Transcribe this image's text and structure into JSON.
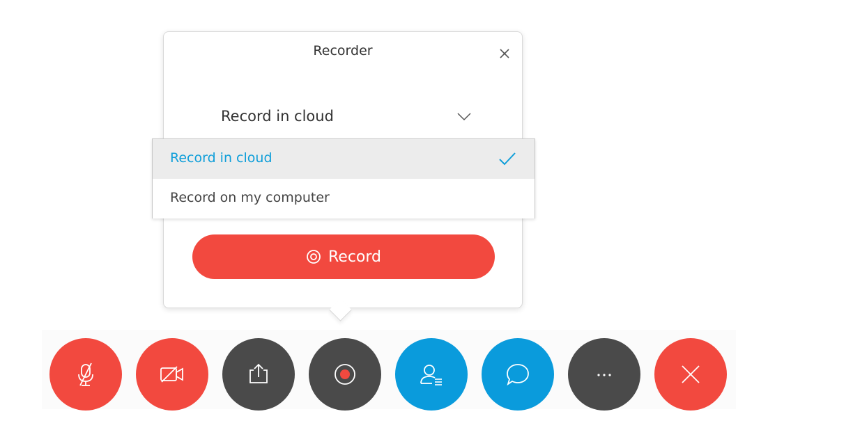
{
  "recorder": {
    "title": "Recorder",
    "mode_selected": "Record in cloud",
    "options": [
      "Record in cloud",
      "Record on my computer"
    ],
    "record_label": "Record"
  },
  "icons": {
    "close": "close-icon",
    "chevron": "chevron-down-icon",
    "check": "check-icon",
    "record": "record-icon"
  },
  "toolbar": {
    "buttons": [
      {
        "name": "mute-button",
        "icon": "microphone-muted-icon",
        "color": "#f2493f"
      },
      {
        "name": "video-button",
        "icon": "video-off-icon",
        "color": "#f2493f"
      },
      {
        "name": "share-button",
        "icon": "share-icon",
        "color": "#4a4a4a"
      },
      {
        "name": "record-button",
        "icon": "record-icon",
        "color": "#4a4a4a"
      },
      {
        "name": "participants-button",
        "icon": "participants-icon",
        "color": "#0a9bdc"
      },
      {
        "name": "chat-button",
        "icon": "chat-icon",
        "color": "#0a9bdc"
      },
      {
        "name": "more-button",
        "icon": "more-icon",
        "color": "#4a4a4a"
      },
      {
        "name": "leave-button",
        "icon": "close-icon",
        "color": "#f2493f"
      }
    ]
  },
  "colors": {
    "accent_blue": "#0e9ed9",
    "record_red": "#f2493f",
    "dark_gray": "#4a4a4a"
  }
}
